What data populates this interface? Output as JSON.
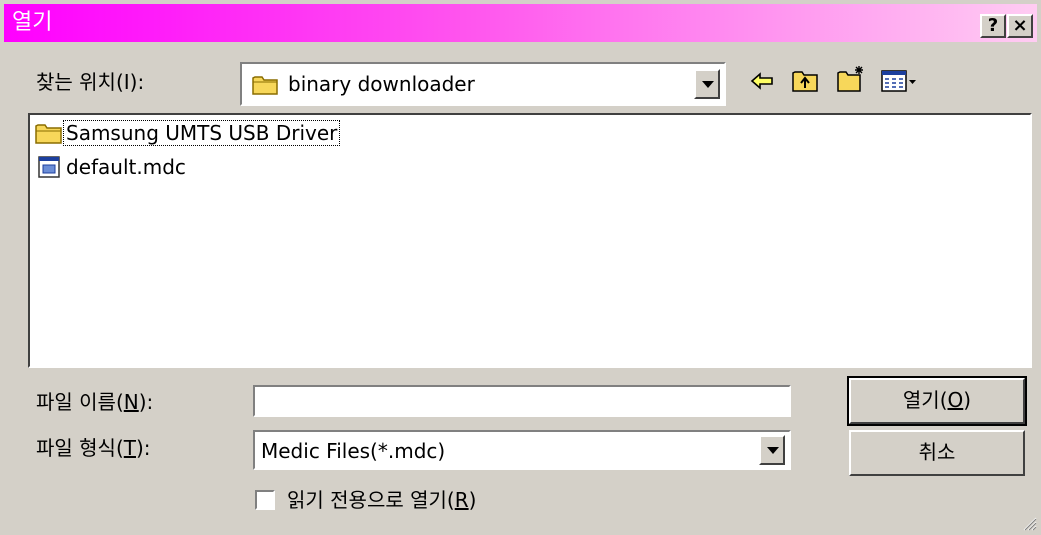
{
  "window": {
    "title": "열기",
    "help_label": "?",
    "close_label": "×"
  },
  "lookin": {
    "label": "찾는 위치(I):",
    "value": "binary downloader"
  },
  "files": [
    {
      "name": "Samsung UMTS USB Driver",
      "type": "folder",
      "icon": "folder-icon"
    },
    {
      "name": "default.mdc",
      "type": "file",
      "icon": "mdc-file-icon"
    }
  ],
  "filename": {
    "label_prefix": "파일 이름(",
    "label_key": "N",
    "label_suffix": "):",
    "value": ""
  },
  "filetype": {
    "label_prefix": "파일 형식(",
    "label_key": "T",
    "label_suffix": "):",
    "value": "Medic Files(*.mdc)"
  },
  "readonly": {
    "label_prefix": "읽기 전용으로 열기(",
    "label_key": "R",
    "label_suffix": ")",
    "checked": false
  },
  "buttons": {
    "open_prefix": "열기(",
    "open_key": "O",
    "open_suffix": ")",
    "cancel": "취소"
  },
  "toolbar": {
    "back_icon": "back-arrow-icon",
    "up_icon": "up-folder-icon",
    "new_folder_icon": "new-folder-icon",
    "view_icon": "view-menu-icon"
  },
  "colors": {
    "titlebar_start": "#ff00ff",
    "titlebar_end": "#ffccf2",
    "face": "#d4d0c8"
  }
}
